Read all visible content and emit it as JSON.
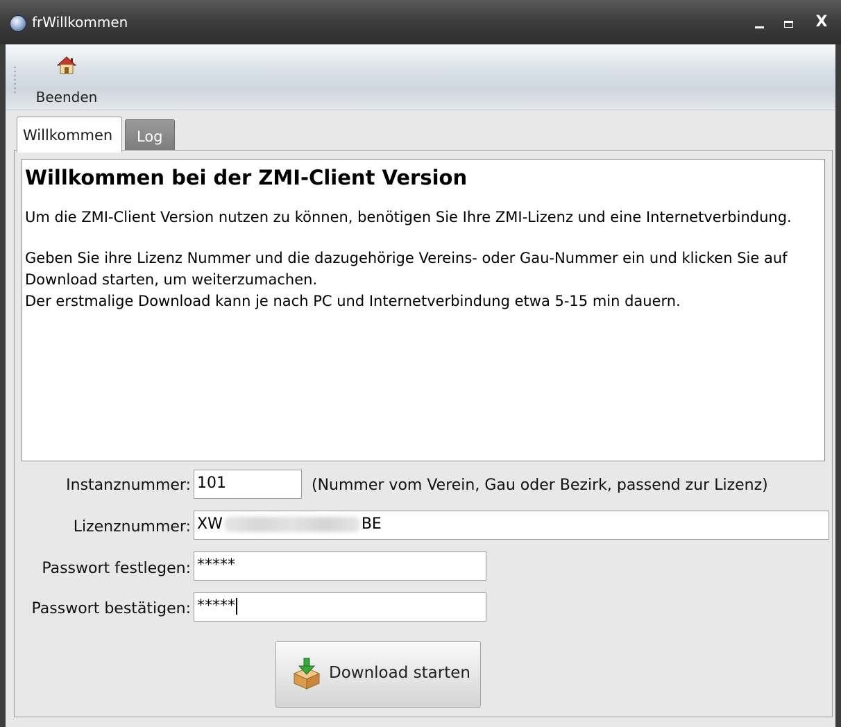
{
  "window": {
    "title": "frWillkommen",
    "minimize_glyph": "",
    "close_glyph": "X"
  },
  "toolbar": {
    "beenden_label": "Beenden",
    "beenden_icon": "house-icon"
  },
  "tabs": [
    {
      "label": "Willkommen",
      "active": true
    },
    {
      "label": "Log",
      "active": false
    }
  ],
  "welcome": {
    "title": "Willkommen bei der ZMI-Client Version",
    "paragraph1": "Um die ZMI-Client Version nutzen zu können, benötigen Sie Ihre ZMI-Lizenz und eine Internetverbindung.",
    "paragraph2_line1": "Geben Sie ihre Lizenz Nummer und die dazugehörige Vereins- oder Gau-Nummer ein und klicken Sie auf Download starten, um weiterzumachen.",
    "paragraph2_line2": "Der erstmalige Download kann je nach PC und Internetverbindung etwa 5-15 min dauern."
  },
  "form": {
    "instanz_label": "Instanznummer:",
    "instanz_value": "101",
    "instanz_hint": "(Nummer vom Verein, Gau oder Bezirk, passend zur Lizenz)",
    "lizenz_label": "Lizenznummer:",
    "lizenz_value_start": "XW",
    "lizenz_value_end": "BE",
    "passwort_label": "Passwort festlegen:",
    "passwort_value": "*****",
    "bestaetigen_label": "Passwort bestätigen:",
    "bestaetigen_value": "*****"
  },
  "download_button": {
    "label": "Download starten",
    "icon": "box-download-icon"
  },
  "colors": {
    "titlebar": "#3e3e3e",
    "client_bg": "#e8e8e8",
    "tab_inactive": "#7c7c7c"
  }
}
